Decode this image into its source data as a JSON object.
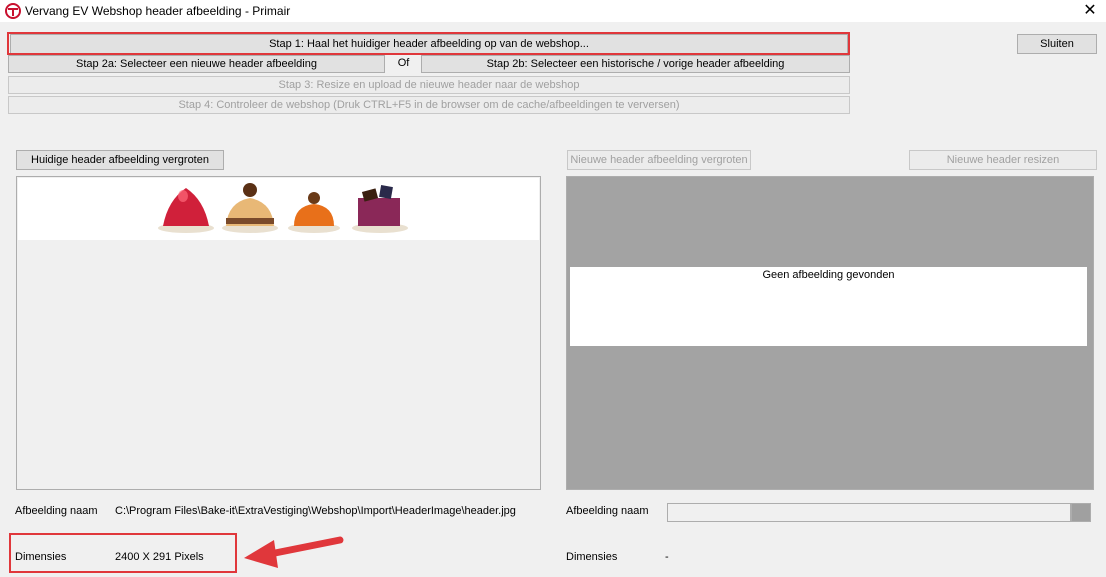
{
  "window": {
    "title": "Vervang EV Webshop header afbeelding - Primair",
    "close_glyph": "✕"
  },
  "steps": {
    "step1": "Stap 1: Haal het huidiger header afbeelding op van de webshop...",
    "step2a": "Stap 2a: Selecteer een nieuwe header afbeelding",
    "or": "Of",
    "step2b": "Stap 2b: Selecteer een historische / vorige header afbeelding",
    "step3": "Stap 3: Resize en upload de nieuwe header naar de webshop",
    "step4": "Stap 4: Controleer de webshop (Druk CTRL+F5 in de browser om de cache/afbeeldingen te verversen)"
  },
  "close_button": "Sluiten",
  "current": {
    "enlarge_button": "Huidige header afbeelding vergroten",
    "name_label": "Afbeelding naam",
    "name_value": "C:\\Program Files\\Bake-it\\ExtraVestiging\\Webshop\\Import\\HeaderImage\\header.jpg",
    "dim_label": "Dimensies",
    "dim_value": "2400 X 291 Pixels"
  },
  "new": {
    "enlarge_button": "Nieuwe header afbeelding vergroten",
    "resize_button": "Nieuwe header resizen",
    "no_image_text": "Geen afbeelding gevonden",
    "name_label": "Afbeelding naam",
    "name_value": "",
    "dim_label": "Dimensies",
    "dim_value": "-"
  },
  "colors": {
    "highlight": "#e0373b",
    "dialog_bg": "#f0f0f0",
    "empty_preview_bg": "#a3a3a3"
  }
}
